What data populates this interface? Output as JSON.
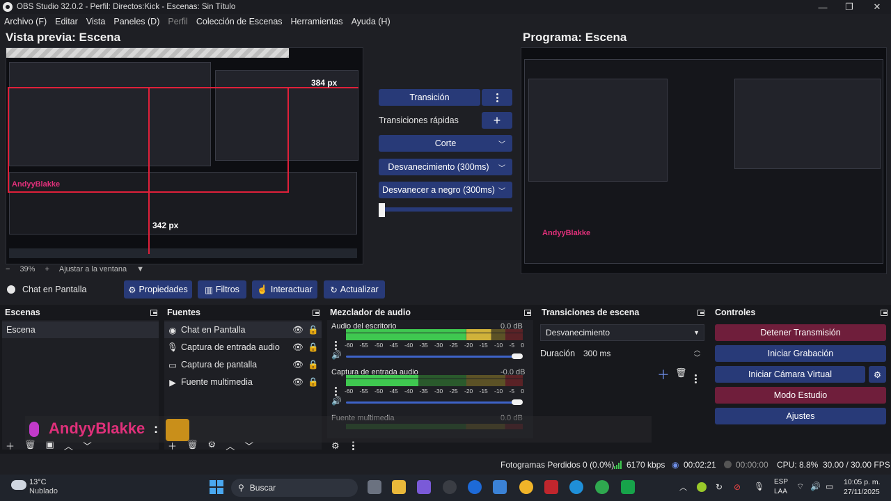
{
  "window": {
    "title": "OBS Studio 32.0.2 - Perfil: Directos:Kick - Escenas: Sin Título",
    "min": "—",
    "max": "❐",
    "close": "✕"
  },
  "menu": [
    "Archivo (F)",
    "Editar",
    "Vista",
    "Paneles (D)",
    "Perfil",
    "Colección de Escenas",
    "Herramientas",
    "Ayuda (H)"
  ],
  "preview": {
    "title": "Vista previa: Escena",
    "size_w": "384 px",
    "size_h": "342 px",
    "zoom_minus": "−",
    "zoom": "39%",
    "zoom_plus": "+",
    "fit": "Ajustar a la ventana"
  },
  "program": {
    "title": "Programa: Escena"
  },
  "transition_panel": {
    "transition_btn": "Transición",
    "quick_label": "Transiciones rápidas",
    "add": "+",
    "items": [
      "Corte",
      "Desvanecimiento (300ms)",
      "Desvanecer a negro (300ms)"
    ]
  },
  "source_toolbar": {
    "source_name": "Chat en Pantalla",
    "props": "Propiedades",
    "filters": "Filtros",
    "interact": "Interactuar",
    "refresh": "Actualizar"
  },
  "docks": {
    "scenes": {
      "title": "Escenas",
      "items": [
        "Escena"
      ]
    },
    "sources": {
      "title": "Fuentes",
      "items": [
        "Chat en Pantalla",
        "Captura de entrada audio",
        "Captura de pantalla",
        "Fuente multimedia"
      ]
    },
    "mixer": {
      "title": "Mezclador de audio",
      "channels": [
        {
          "name": "Audio del escritorio",
          "db": "0.0 dB",
          "level": 0.82
        },
        {
          "name": "Captura de entrada audio",
          "db": "-0.0 dB",
          "level": 0.41
        },
        {
          "name": "Fuente multimedia",
          "db": "0.0 dB",
          "level": 0.0
        }
      ],
      "ticks": [
        "-60",
        "-55",
        "-50",
        "-45",
        "-40",
        "-35",
        "-30",
        "-25",
        "-20",
        "-15",
        "-10",
        "-5",
        "0"
      ]
    },
    "transitions": {
      "title": "Transiciones de escena",
      "selected": "Desvanecimiento",
      "duration_label": "Duración",
      "duration": "300 ms"
    },
    "controls": {
      "title": "Controles",
      "stop_stream": "Detener Transmisión",
      "start_rec": "Iniciar Grabación",
      "virtual_cam": "Iniciar Cámara Virtual",
      "studio": "Modo Estudio",
      "settings": "Ajustes"
    }
  },
  "chat_overlay": {
    "user": "AndyyBlakke",
    "sep": ":"
  },
  "statusbar": {
    "dropped": "Fotogramas Perdidos 0 (0.0%)",
    "kbps": "6170 kbps",
    "stream_time": "00:02:21",
    "rec_time": "00:00:00",
    "cpu": "CPU: 8.8%",
    "fps": "30.00 / 30.00 FPS"
  },
  "taskbar": {
    "temp": "13°C",
    "weather": "Nublado",
    "search": "Buscar",
    "lang1": "ESP",
    "lang2": "LAA",
    "time": "10:05 p. m.",
    "date": "27/11/2025"
  }
}
